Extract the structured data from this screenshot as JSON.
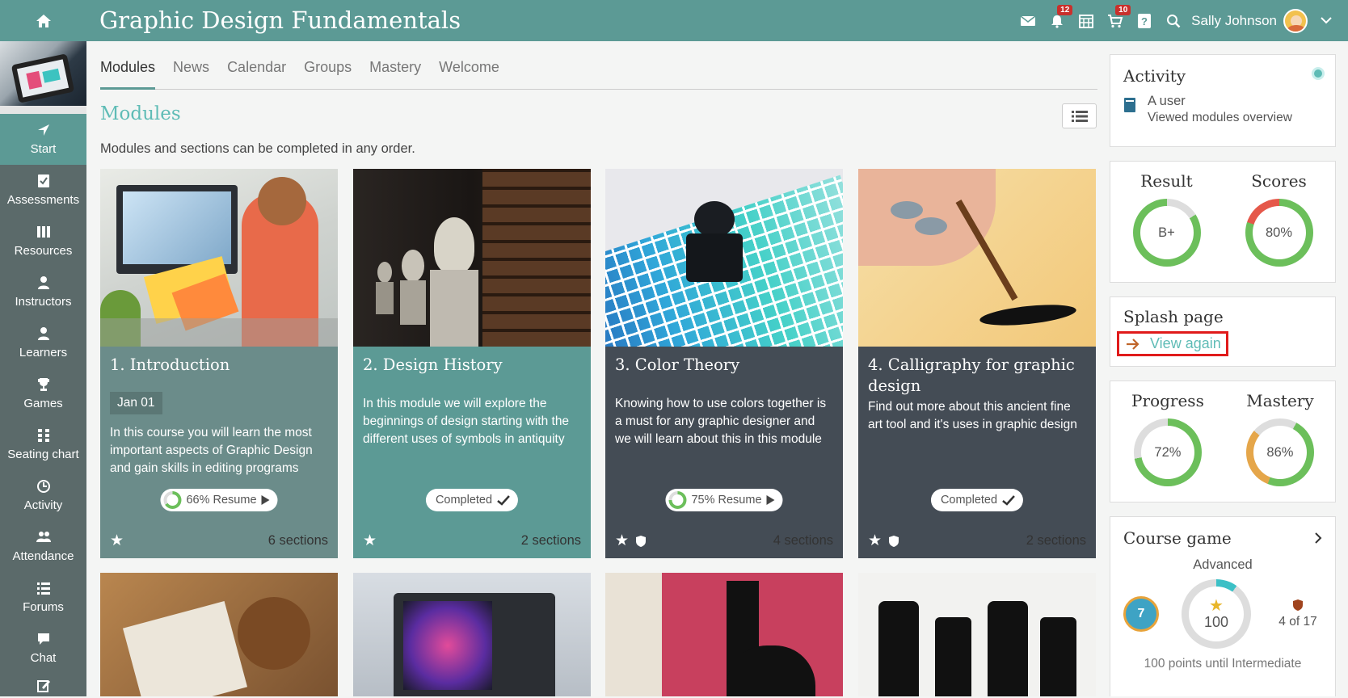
{
  "topbar": {
    "title": "Graphic Design Fundamentals",
    "notifications_badge": "12",
    "cart_badge": "10",
    "user_name": "Sally Johnson"
  },
  "sidebar": {
    "items": [
      {
        "label": "Start",
        "icon": "start-icon"
      },
      {
        "label": "Assessments",
        "icon": "assessments-icon"
      },
      {
        "label": "Resources",
        "icon": "resources-icon"
      },
      {
        "label": "Instructors",
        "icon": "instructors-icon"
      },
      {
        "label": "Learners",
        "icon": "learners-icon"
      },
      {
        "label": "Games",
        "icon": "trophy-icon"
      },
      {
        "label": "Seating chart",
        "icon": "seating-chart-icon"
      },
      {
        "label": "Activity",
        "icon": "activity-icon"
      },
      {
        "label": "Attendance",
        "icon": "attendance-icon"
      },
      {
        "label": "Forums",
        "icon": "forums-icon"
      },
      {
        "label": "Chat",
        "icon": "chat-icon"
      }
    ]
  },
  "tabs": [
    "Modules",
    "News",
    "Calendar",
    "Groups",
    "Mastery",
    "Welcome"
  ],
  "modules": {
    "heading": "Modules",
    "description": "Modules and sections can be completed in any order.",
    "cards": [
      {
        "title": "1. Introduction",
        "date": "Jan 01",
        "desc": "In this course you will learn the most important aspects of Graphic Design and gain skills in editing programs",
        "status": "66% Resume",
        "progress": 66,
        "sections": "6 sections",
        "color": "#6b8c8a"
      },
      {
        "title": "2. Design History",
        "desc": "In this module we will explore the beginnings of design starting with the different uses of symbols in antiquity",
        "status": "Completed",
        "sections": "2 sections",
        "color": "#5c9a95"
      },
      {
        "title": "3. Color Theory",
        "desc": "Knowing how to use colors together is a must for any graphic designer and we will learn about this in this module",
        "status": "75% Resume",
        "progress": 75,
        "sections": "4 sections",
        "color": "#444c55"
      },
      {
        "title": "4. Calligraphy for graphic design",
        "desc": "Find out more about this ancient fine art tool and it's uses in graphic design",
        "status": "Completed",
        "sections": "2 sections",
        "color": "#444c55"
      }
    ]
  },
  "activity": {
    "title": "Activity",
    "user": "A user",
    "action": "Viewed modules overview"
  },
  "result_scores": {
    "result_label": "Result",
    "result_value": "B+",
    "scores_label": "Scores",
    "scores_value": "80%"
  },
  "splash": {
    "title": "Splash page",
    "link": "View again"
  },
  "progress_mastery": {
    "progress_label": "Progress",
    "progress_value": "72%",
    "mastery_label": "Mastery",
    "mastery_value": "86%"
  },
  "course_game": {
    "title": "Course game",
    "level": "Advanced",
    "avatar_number": "7",
    "points": "100",
    "rank": "4 of 17",
    "next": "100 points until Intermediate"
  },
  "colors": {
    "brand": "#5c9a95",
    "accent": "#5fbcb6",
    "sidebar": "#5b6a6a",
    "ring_green": "#6cbf5b",
    "ring_red": "#e5584a",
    "ring_orange": "#e5a64a"
  }
}
